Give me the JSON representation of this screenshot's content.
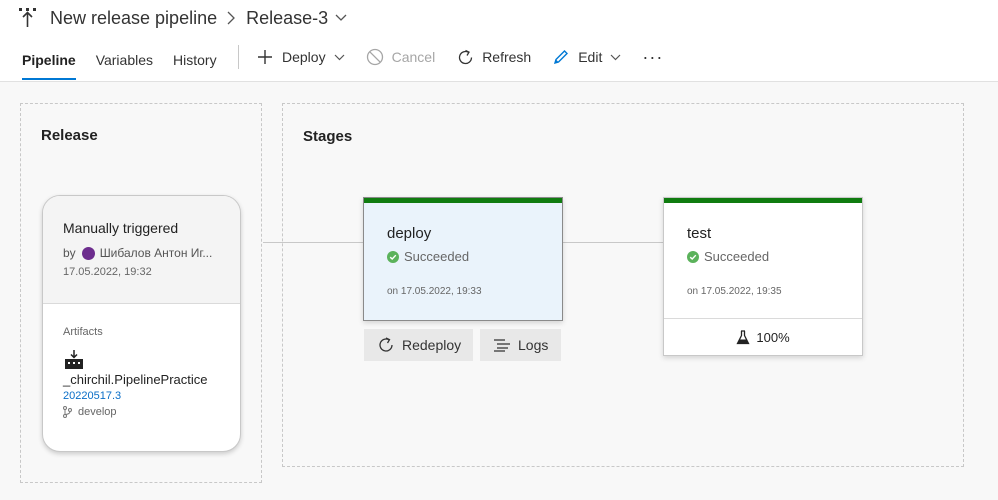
{
  "breadcrumb": {
    "pipeline_icon": "pipeline-icon",
    "pipeline_name": "New release pipeline",
    "release_name": "Release-3"
  },
  "tabs": [
    {
      "label": "Pipeline",
      "active": true
    },
    {
      "label": "Variables",
      "active": false
    },
    {
      "label": "History",
      "active": false
    }
  ],
  "toolbar": {
    "deploy_label": "Deploy",
    "cancel_label": "Cancel",
    "refresh_label": "Refresh",
    "edit_label": "Edit",
    "more_label": "···"
  },
  "release": {
    "section_title": "Release",
    "trigger": "Manually triggered",
    "by_prefix": "by",
    "by_user": "Шибалов Антон Иг...",
    "date": "17.05.2022, 19:32",
    "artifacts_label": "Artifacts",
    "artifact_name": "_chirchil.PipelinePractice",
    "artifact_build": "20220517.3",
    "artifact_branch": "develop"
  },
  "stages": {
    "section_title": "Stages",
    "items": [
      {
        "name": "deploy",
        "status": "Succeeded",
        "date": "on 17.05.2022, 19:33",
        "actions": {
          "redeploy_label": "Redeploy",
          "logs_label": "Logs"
        }
      },
      {
        "name": "test",
        "status": "Succeeded",
        "date": "on 17.05.2022, 19:35",
        "test_pass_rate": "100%"
      }
    ]
  },
  "colors": {
    "accent": "#0078d4",
    "success": "#107c10",
    "success_icon": "#5bb25b",
    "link": "#0a6ec7",
    "selected_stage_bg": "#eaf3fb"
  }
}
